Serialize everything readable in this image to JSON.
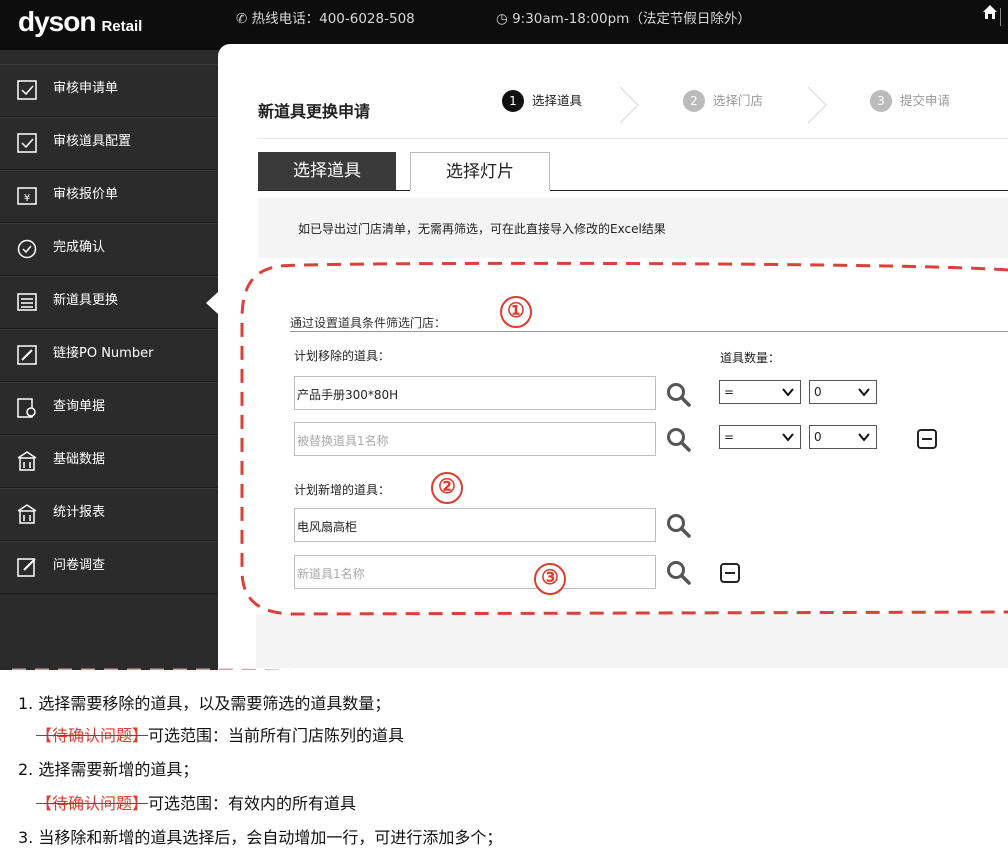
{
  "header": {
    "logo_main": "dyson",
    "logo_sub": "Retail",
    "hotline": "热线电话：400-6028-508",
    "hours": "9:30am-18:00pm（法定节假日除外）"
  },
  "sidebar": {
    "items": [
      {
        "label": "审核申请单",
        "icon": "review-icon"
      },
      {
        "label": "审核道具配置",
        "icon": "review-icon"
      },
      {
        "label": "审核报价单",
        "icon": "quote-icon"
      },
      {
        "label": "完成确认",
        "icon": "check-circle-icon"
      },
      {
        "label": "新道具更换",
        "icon": "list-icon",
        "active": true
      },
      {
        "label": "链接PO Number",
        "icon": "link-icon"
      },
      {
        "label": "查询单据",
        "icon": "search-doc-icon"
      },
      {
        "label": "基础数据",
        "icon": "building-icon"
      },
      {
        "label": "统计报表",
        "icon": "building-icon"
      },
      {
        "label": "问卷调查",
        "icon": "edit-icon"
      }
    ]
  },
  "page": {
    "title": "新道具更换申请",
    "steps": [
      {
        "num": "1",
        "label": "选择道具"
      },
      {
        "num": "2",
        "label": "选择门店"
      },
      {
        "num": "3",
        "label": "提交申请"
      }
    ],
    "tabs": [
      "选择道具",
      "选择灯片"
    ],
    "notice": "如已导出过门店清单，无需再筛选，可在此直接导入修改的Excel结果",
    "filter_title": "通过设置道具条件筛选门店：",
    "remove_label": "计划移除的道具：",
    "qty_label": "道具数量：",
    "add_label": "计划新增的道具：",
    "remove_rows": [
      {
        "value": "产品手册300*80H",
        "placeholder": "",
        "op": "=",
        "qty": "0"
      },
      {
        "value": "",
        "placeholder": "被替换道具1名称",
        "op": "=",
        "qty": "0"
      }
    ],
    "add_rows": [
      {
        "value": "电风扇高柜",
        "placeholder": ""
      },
      {
        "value": "",
        "placeholder": "新道具1名称"
      }
    ]
  },
  "annotations": {
    "markers": [
      "①",
      "②",
      "③"
    ],
    "accent_color": "#e03b2f",
    "notes": {
      "n1": "1. 选择需要移除的道具，以及需要筛选的道具数量；",
      "n1_tag": "【待确认问题】",
      "n1_sub": "可选范围：当前所有门店陈列的道具",
      "n2": "2. 选择需要新增的道具；",
      "n2_tag": "【待确认问题】",
      "n2_sub": "可选范围：有效内的所有道具",
      "n3": "3. 当移除和新增的道具选择后，会自动增加一行，可进行添加多个；"
    }
  }
}
